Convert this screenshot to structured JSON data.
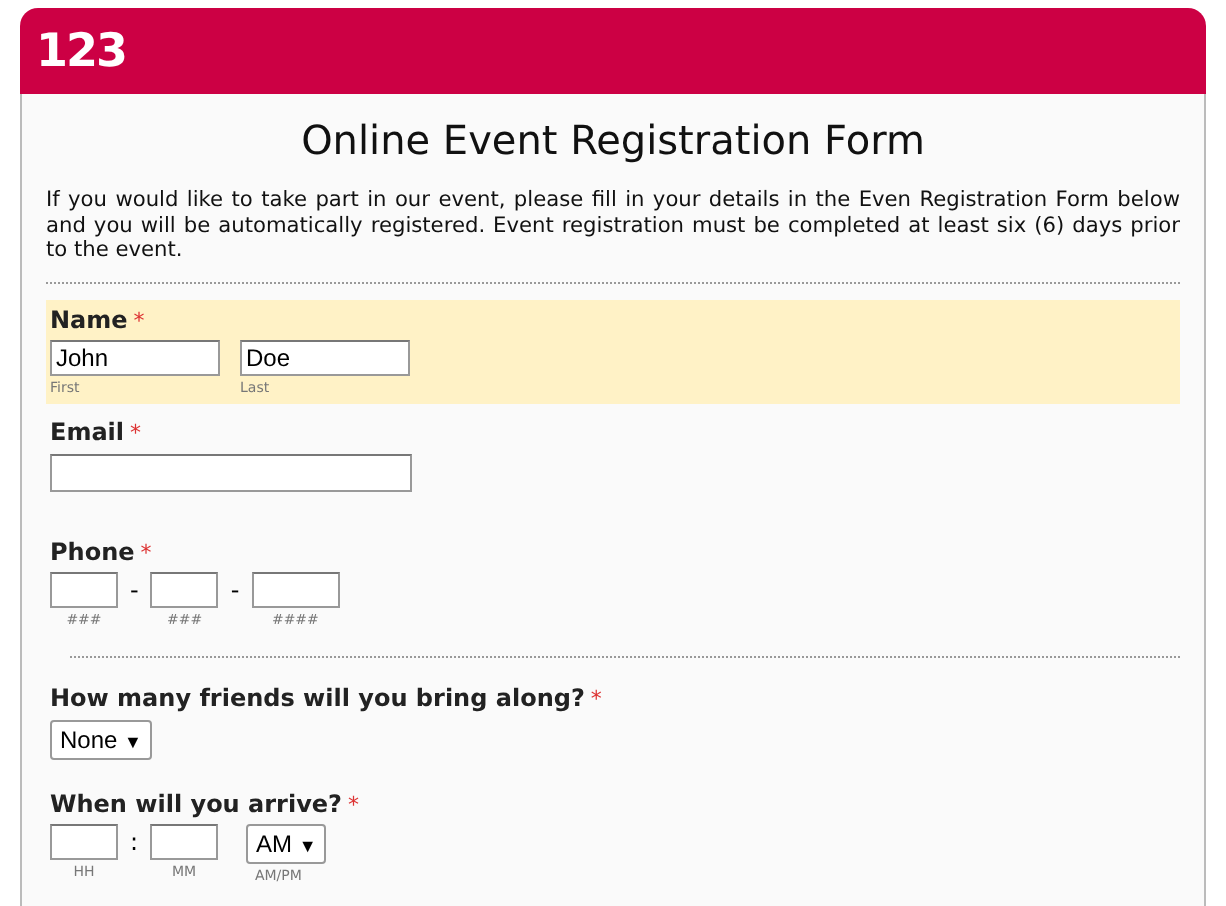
{
  "logo": "123",
  "title": "Online Event Registration Form",
  "intro": "If you would like to take part in our event, please fill in your details in the Even Registration Form below and you will be automatically registered. Event registration must be completed at least six (6) days prior to the event.",
  "fields": [
    {
      "kind": "name",
      "label": "Name",
      "required": "*",
      "highlighted": true,
      "parts": [
        {
          "value": "John",
          "sublabel": "First"
        },
        {
          "value": "Doe",
          "sublabel": "Last"
        }
      ]
    },
    {
      "kind": "text",
      "label": "Email",
      "required": "*",
      "highlighted": false
    },
    {
      "kind": "phone",
      "label": "Phone",
      "required": "*",
      "highlighted": false,
      "separators": [
        "-",
        "-"
      ],
      "parts": [
        {
          "sublabel": "###"
        },
        {
          "sublabel": "###"
        },
        {
          "sublabel": "####"
        }
      ]
    },
    {
      "kind": "divider"
    },
    {
      "kind": "select",
      "label": "How many friends will you bring along?",
      "required": "*",
      "highlighted": false,
      "value": "None",
      "arrow": "▼"
    },
    {
      "kind": "time",
      "label": "When will you arrive?",
      "required": "*",
      "highlighted": false,
      "separator": ":",
      "parts": [
        {
          "sublabel": "HH"
        },
        {
          "sublabel": "MM"
        }
      ],
      "ampm": {
        "value": "AM",
        "arrow": "▼",
        "sublabel": "AM/PM"
      }
    }
  ]
}
